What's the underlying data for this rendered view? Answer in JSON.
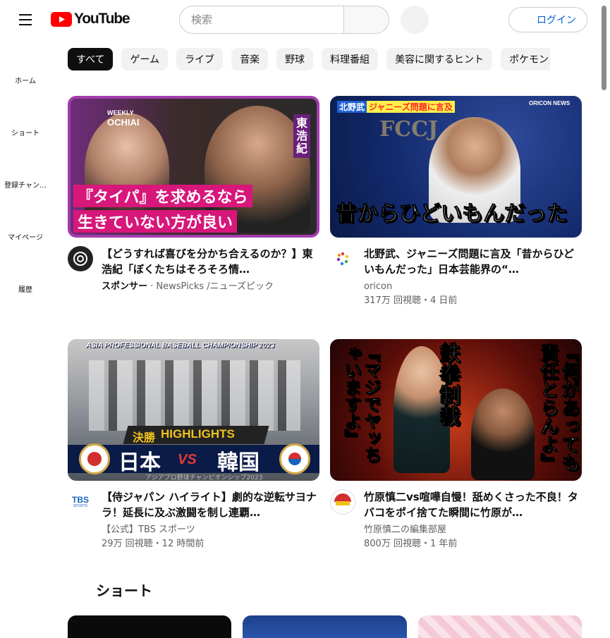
{
  "header": {
    "logo_text": "YouTube",
    "search_placeholder": "検索",
    "login_label": "ログイン"
  },
  "sidebar": {
    "items": [
      {
        "label": "ホーム",
        "icon": "home-icon"
      },
      {
        "label": "ショート",
        "icon": "shorts-icon"
      },
      {
        "label": "登録チャン…",
        "icon": "subscriptions-icon"
      },
      {
        "label": "マイページ",
        "icon": "library-icon"
      },
      {
        "label": "履歴",
        "icon": "history-icon"
      }
    ]
  },
  "chips": [
    "すべて",
    "ゲーム",
    "ライブ",
    "音楽",
    "野球",
    "料理番組",
    "美容に関するヒント",
    "ポケモン"
  ],
  "videos": [
    {
      "title": "【どうすれば喜びを分かち合えるのか？】東浩紀「ぼくたちはそろそろ情…",
      "sponsor": "スポンサー",
      "channel": " · NewsPicks /ニューズピック",
      "stats": "",
      "thumb_text": {
        "brand_top": "WEEKLY",
        "brand": "OCHIAI",
        "name": "東浩紀",
        "line1": "『タイパ』を求めるなら",
        "line2": "生きていない方が良い"
      }
    },
    {
      "title": "北野武、ジャニーズ問題に言及「昔からひどいもんだった」日本芸能界の“…",
      "channel": "oricon",
      "stats": "317万 回視聴・4 日前",
      "thumb_text": {
        "tag1": "北野武",
        "tag2": "ジャニーズ問題に言及",
        "caption": "昔からひどいもんだった",
        "backdrop": "FCCJ",
        "org": "ORICON NEWS"
      }
    },
    {
      "title": "【侍ジャパン ハイライト】劇的な逆転サヨナラ！延長に及ぶ激闘を制し連覇…",
      "channel": "【公式】TBS スポーツ",
      "stats": "29万 回視聴・12 時間前",
      "avatar_text": "TBS",
      "avatar_sub": "SPORTS",
      "thumb_text": {
        "banner": "ASIA PROFESSIONAL BASEBALL CHAMPIONSHIP 2023",
        "label1": "決勝",
        "label2": "HIGHLIGHTS",
        "team1": "日本",
        "vs": "VS",
        "team2": "韓国",
        "footer": "アジアプロ野球チャンピオンシップ2023"
      }
    },
    {
      "title": "竹原慎二vs喧嘩自慢！舐めくさった不良！タバコをポイ捨てた瞬間に竹原が…",
      "channel": "竹原慎二の編集部屋",
      "stats": "800万 回視聴・1 年前",
      "thumb_text": {
        "left": "『マジでヤッちゃいますよ』",
        "mid": "鉄拳制裁",
        "right": "『何があっても責任とらんよ』"
      }
    }
  ],
  "shorts_section": {
    "title": "ショート"
  },
  "colors": {
    "brand_red": "#ff0000",
    "link_blue": "#065fd4",
    "chip_active_bg": "#0f0f0f",
    "chip_bg": "#f2f2f2"
  }
}
